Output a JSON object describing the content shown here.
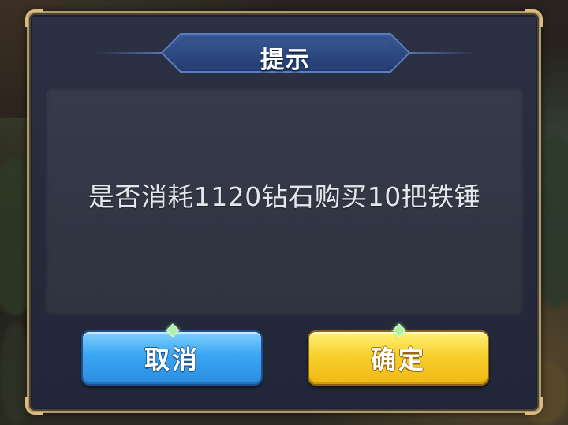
{
  "dialog": {
    "title": "提示",
    "message": "是否消耗1120钻石购买10把铁锤",
    "cancel_label": "取消",
    "confirm_label": "确定"
  },
  "colors": {
    "frame_gold": "#b39a6a",
    "panel_bg": "#2c3144",
    "cancel_blue": "#3aa6f2",
    "confirm_yellow": "#f7d02c"
  }
}
